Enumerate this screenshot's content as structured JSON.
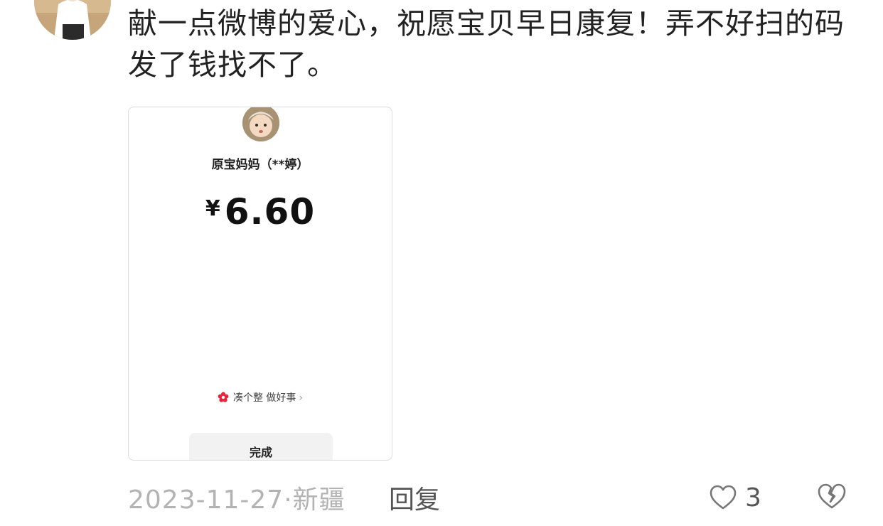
{
  "comment": {
    "text": "献一点微博的爱心，祝愿宝贝早日康复！弄不好扫的码发了钱找不了。"
  },
  "attachment": {
    "payee": "原宝妈妈（**婷）",
    "currency": "¥",
    "amount": "6.60",
    "round_up_label": "凑个整 做好事",
    "round_up_chevron": "›",
    "done_label": "完成"
  },
  "footer": {
    "date": "2023-11-27",
    "separator": "·",
    "location": "新疆",
    "reply_label": "回复",
    "like_count": "3"
  },
  "icons": {
    "like": "heart-outline-icon",
    "dislike": "broken-heart-icon",
    "round_up": "red-flower-icon"
  },
  "colors": {
    "text": "#222222",
    "meta": "#b3b3b3",
    "action": "#555555",
    "flower": "#e8243a"
  }
}
